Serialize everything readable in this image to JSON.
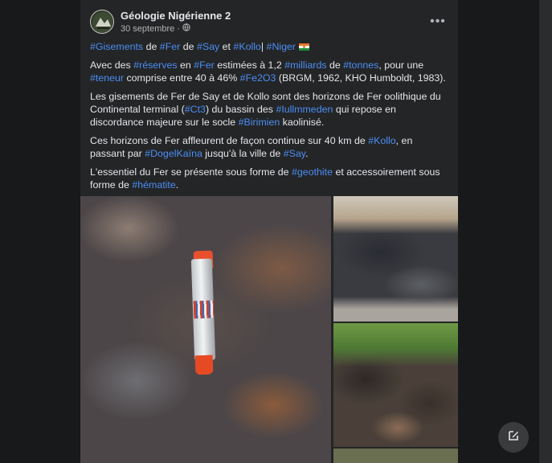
{
  "post": {
    "author": "Géologie Nigérienne 2",
    "date": "30 septembre",
    "separator": "·",
    "privacy_icon": "globe-icon",
    "more_label": "•••",
    "paragraphs": {
      "p1": {
        "t1": "#Gisements",
        "t2": " de ",
        "t3": "#Fer",
        "t4": " de ",
        "t5": "#Say",
        "t6": " et ",
        "t7": "#Kollo",
        "t8": "| ",
        "t9": "#Niger"
      },
      "p2": {
        "t1": "Avec des ",
        "t2": "#réserves",
        "t3": " en ",
        "t4": "#Fer",
        "t5": " estimées à 1,2 ",
        "t6": "#milliards",
        "t7": " de ",
        "t8": "#tonnes",
        "t9": ", pour une ",
        "t10": "#teneur",
        "t11": " comprise entre 40 à 46% ",
        "t12": "#Fe2O3",
        "t13": " (BRGM, 1962, KHO Humboldt, 1983)."
      },
      "p3": {
        "t1": "Les gisements de Fer de Say et de Kollo sont des horizons de Fer oolithique du Continental terminal (",
        "t2": "#Ct3",
        "t3": ") du bassin des ",
        "t4": "#Iullmmeden",
        "t5": " qui repose en discordance majeure sur le socle ",
        "t6": "#Birimien",
        "t7": " kaolinisé."
      },
      "p4": {
        "t1": "Ces horizons de Fer affleurent de façon continue sur 40 km de ",
        "t2": "#Kollo",
        "t3": ", en passant par ",
        "t4": "#DogelKaïna",
        "t5": " jusqu'à la ville de ",
        "t6": "#Say",
        "t7": "."
      },
      "p5": {
        "t1": "L'essentiel du Fer se présente sous forme de ",
        "t2": "#geothite",
        "t3": " et accessoirement sous forme de ",
        "t4": "#hématite",
        "t5": "."
      }
    }
  },
  "colors": {
    "background": "#18191a",
    "card": "#242526",
    "hashtag": "#4b8ef5",
    "text": "#e4e6eb",
    "muted": "#b0b3b8"
  },
  "compose_icon": "edit-icon"
}
